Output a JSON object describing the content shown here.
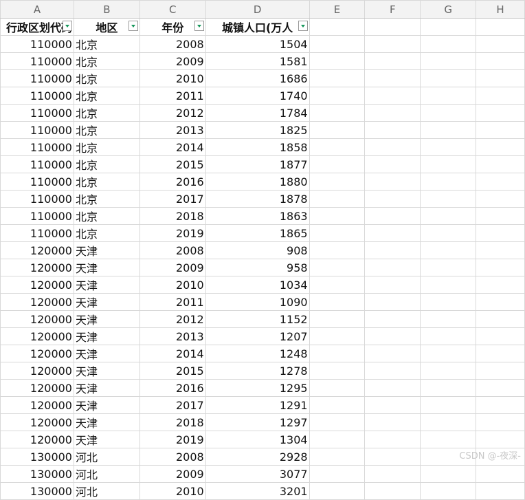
{
  "columns": [
    "A",
    "B",
    "C",
    "D",
    "E",
    "F",
    "G",
    "H"
  ],
  "headers": {
    "a": "行政区划代码",
    "b": "地区",
    "c": "年份",
    "d": "城镇人口(万人"
  },
  "rows": [
    {
      "code": "110000",
      "region": "北京",
      "year": "2008",
      "pop": "1504"
    },
    {
      "code": "110000",
      "region": "北京",
      "year": "2009",
      "pop": "1581"
    },
    {
      "code": "110000",
      "region": "北京",
      "year": "2010",
      "pop": "1686"
    },
    {
      "code": "110000",
      "region": "北京",
      "year": "2011",
      "pop": "1740"
    },
    {
      "code": "110000",
      "region": "北京",
      "year": "2012",
      "pop": "1784"
    },
    {
      "code": "110000",
      "region": "北京",
      "year": "2013",
      "pop": "1825"
    },
    {
      "code": "110000",
      "region": "北京",
      "year": "2014",
      "pop": "1858"
    },
    {
      "code": "110000",
      "region": "北京",
      "year": "2015",
      "pop": "1877"
    },
    {
      "code": "110000",
      "region": "北京",
      "year": "2016",
      "pop": "1880"
    },
    {
      "code": "110000",
      "region": "北京",
      "year": "2017",
      "pop": "1878"
    },
    {
      "code": "110000",
      "region": "北京",
      "year": "2018",
      "pop": "1863"
    },
    {
      "code": "110000",
      "region": "北京",
      "year": "2019",
      "pop": "1865"
    },
    {
      "code": "120000",
      "region": "天津",
      "year": "2008",
      "pop": "908"
    },
    {
      "code": "120000",
      "region": "天津",
      "year": "2009",
      "pop": "958"
    },
    {
      "code": "120000",
      "region": "天津",
      "year": "2010",
      "pop": "1034"
    },
    {
      "code": "120000",
      "region": "天津",
      "year": "2011",
      "pop": "1090"
    },
    {
      "code": "120000",
      "region": "天津",
      "year": "2012",
      "pop": "1152"
    },
    {
      "code": "120000",
      "region": "天津",
      "year": "2013",
      "pop": "1207"
    },
    {
      "code": "120000",
      "region": "天津",
      "year": "2014",
      "pop": "1248"
    },
    {
      "code": "120000",
      "region": "天津",
      "year": "2015",
      "pop": "1278"
    },
    {
      "code": "120000",
      "region": "天津",
      "year": "2016",
      "pop": "1295"
    },
    {
      "code": "120000",
      "region": "天津",
      "year": "2017",
      "pop": "1291"
    },
    {
      "code": "120000",
      "region": "天津",
      "year": "2018",
      "pop": "1297"
    },
    {
      "code": "120000",
      "region": "天津",
      "year": "2019",
      "pop": "1304"
    },
    {
      "code": "130000",
      "region": "河北",
      "year": "2008",
      "pop": "2928"
    },
    {
      "code": "130000",
      "region": "河北",
      "year": "2009",
      "pop": "3077"
    },
    {
      "code": "130000",
      "region": "河北",
      "year": "2010",
      "pop": "3201"
    }
  ],
  "watermark": "CSDN @-夜深-",
  "colors": {
    "filter_arrow": "#17975b",
    "grid": "#d8d8d8",
    "header_bg": "#f3f3f3"
  }
}
